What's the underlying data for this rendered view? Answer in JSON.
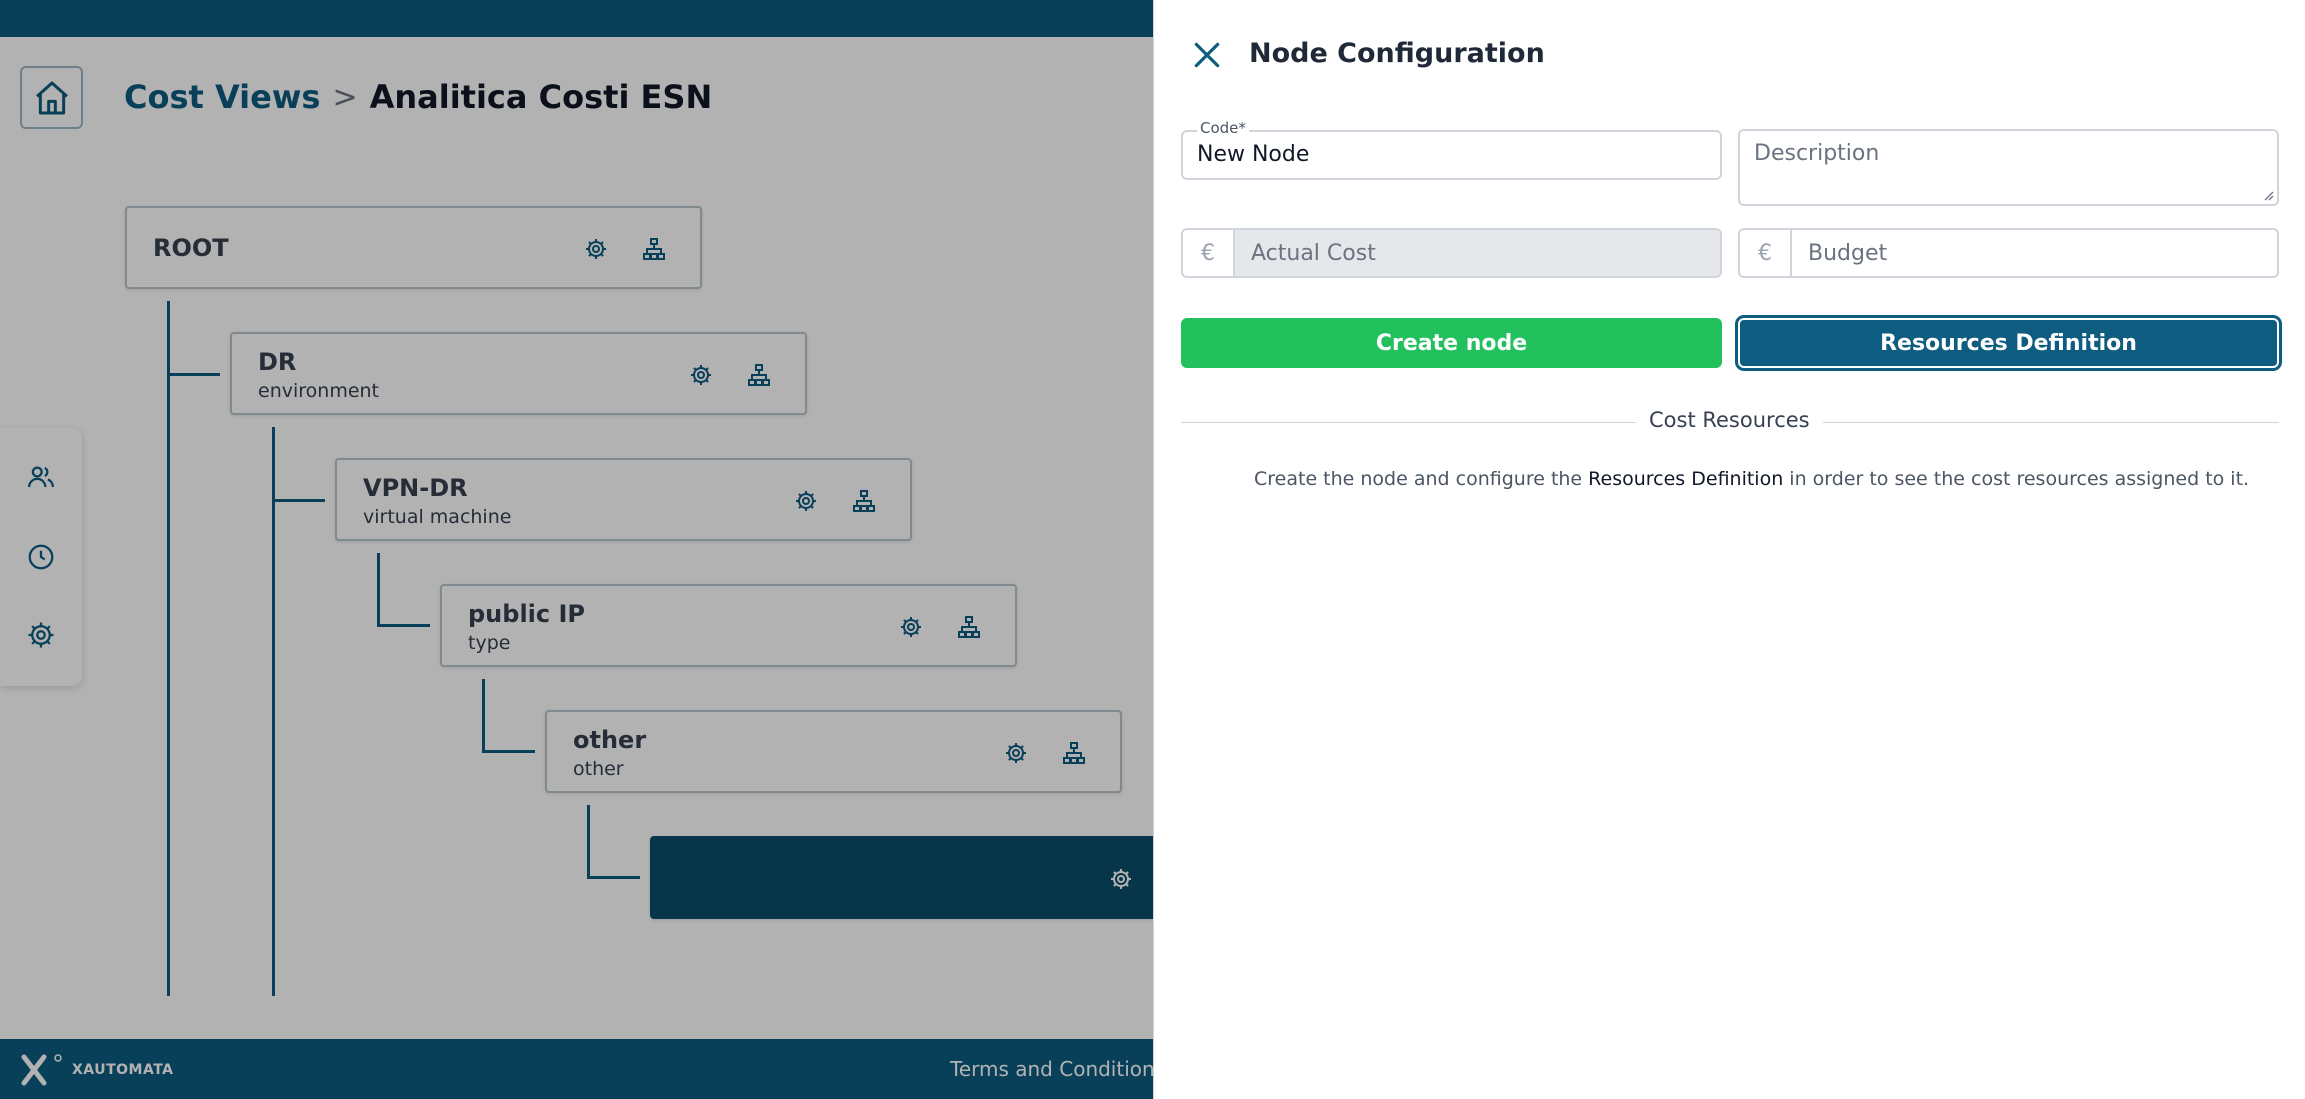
{
  "breadcrumb": {
    "parent": "Cost Views",
    "separator": ">",
    "current": "Analitica Costi ESN"
  },
  "side_menu": {
    "icons": [
      "users-icon",
      "clock-icon",
      "gear-icon"
    ]
  },
  "tree": {
    "nodes": [
      {
        "title": "ROOT",
        "subtitle": ""
      },
      {
        "title": "DR",
        "subtitle": "environment"
      },
      {
        "title": "VPN-DR",
        "subtitle": "virtual machine"
      },
      {
        "title": "public IP",
        "subtitle": "type"
      },
      {
        "title": "other",
        "subtitle": "other"
      },
      {
        "title": "",
        "subtitle": ""
      }
    ]
  },
  "footer": {
    "logo_text": "XAUTOMATA",
    "terms": "Terms and Conditions"
  },
  "panel": {
    "title": "Node Configuration",
    "code_label": "Code*",
    "code_value": "New Node",
    "description_placeholder": "Description",
    "currency_symbol": "€",
    "actual_cost_placeholder": "Actual Cost",
    "budget_placeholder": "Budget",
    "create_button": "Create node",
    "resources_button": "Resources Definition",
    "section_title": "Cost Resources",
    "info_before": "Create the node and configure the ",
    "info_strong": "Resources Definition",
    "info_after": " in order to see the cost resources assigned to it."
  },
  "colors": {
    "primary": "#0e5c80",
    "success": "#22c15e",
    "selected_node": "#0b4d6b"
  }
}
